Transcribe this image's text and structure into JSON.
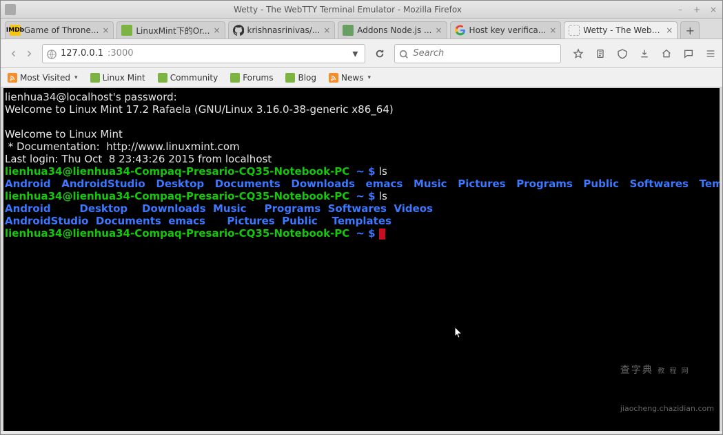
{
  "window": {
    "title": "Wetty - The WebTTY Terminal Emulator - Mozilla Firefox"
  },
  "tabs": [
    {
      "label": "Game of Throne...",
      "favicon": "imdb"
    },
    {
      "label": "LinuxMint下的Or...",
      "favicon": "mint"
    },
    {
      "label": "krishnasrinivas/...",
      "favicon": "github"
    },
    {
      "label": "Addons Node.js ...",
      "favicon": "node"
    },
    {
      "label": "Host key verifica...",
      "favicon": "google"
    },
    {
      "label": "Wetty - The WebTTY ...",
      "favicon": "blank",
      "active": true
    }
  ],
  "nav": {
    "url_prefix": "127.0.0.1",
    "url_suffix": ":3000",
    "search_placeholder": "Search"
  },
  "toolbar_icons": [
    "bookmark-star-icon",
    "reader-icon",
    "pocket-icon",
    "downloads-icon",
    "home-icon",
    "chat-icon",
    "menu-icon"
  ],
  "bookmarks": [
    {
      "label": "Most Visited",
      "icon": "rss",
      "dropdown": true
    },
    {
      "label": "Linux Mint",
      "icon": "mint"
    },
    {
      "label": "Community",
      "icon": "mint"
    },
    {
      "label": "Forums",
      "icon": "mint"
    },
    {
      "label": "Blog",
      "icon": "mint"
    },
    {
      "label": "News",
      "icon": "rss",
      "dropdown": true
    }
  ],
  "terminal": {
    "prompt_user_host": "lienhua34@lienhua34-Compaq-Presario-CQ35-Notebook-PC",
    "prompt_path": "~",
    "prompt_sep": " $ ",
    "lines": {
      "l1": "lienhua34@localhost's password:",
      "l2": "Welcome to Linux Mint 17.2 Rafaela (GNU/Linux 3.16.0-38-generic x86_64)",
      "l3": "",
      "l4": "Welcome to Linux Mint",
      "l5": " * Documentation:  http://www.linuxmint.com",
      "l6": "Last login: Thu Oct  8 23:43:26 2015 from localhost"
    },
    "cmd1": "ls",
    "ls1": "Android   AndroidStudio   Desktop   Documents   Downloads   emacs   Music   Pictures   Programs   Public   Softwares   Templa",
    "cmd2": "ls",
    "ls2a": "Android        Desktop    Downloads  Music     Programs  Softwares  Videos",
    "ls2b": "AndroidStudio  Documents  emacs      Pictures  Public    Templates"
  },
  "watermark": {
    "big": "查字典",
    "small": "教 程 网",
    "url": "jiaocheng.chazidian.com"
  }
}
